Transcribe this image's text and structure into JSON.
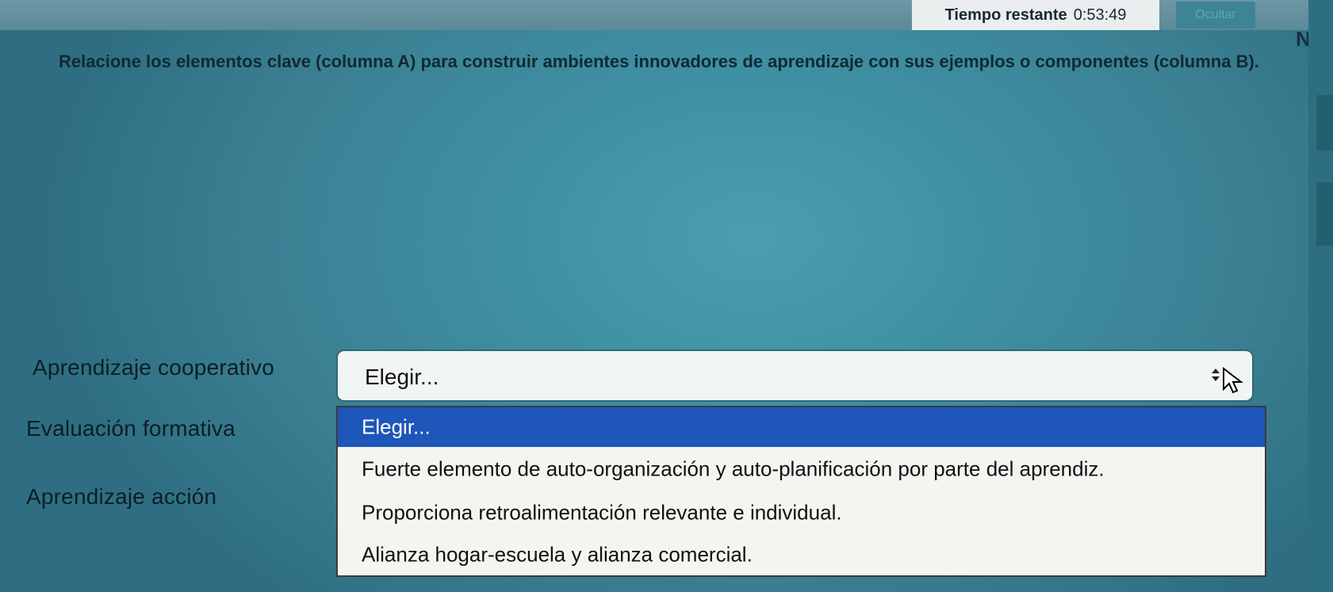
{
  "timer": {
    "label": "Tiempo restante",
    "value": "0:53:49"
  },
  "hide_button": {
    "label": "Ocultar"
  },
  "nav_stub": {
    "label": "Na"
  },
  "question": {
    "text": "Relacione los elementos clave (columna A) para construir ambientes innovadores de aprendizaje con sus ejemplos o componentes (columna B)."
  },
  "rows": [
    {
      "label": "Aprendizaje cooperativo"
    },
    {
      "label": "Evaluación formativa"
    },
    {
      "label": "Aprendizaje acción"
    }
  ],
  "select": {
    "value": "Elegir..."
  },
  "dropdown": {
    "options": [
      {
        "label": "Elegir..."
      },
      {
        "label": "Fuerte elemento de auto-organización y auto-planificación por parte del aprendiz."
      },
      {
        "label": "Proporciona retroalimentación relevante e individual."
      },
      {
        "label": "Alianza hogar-escuela y alianza comercial."
      }
    ],
    "selected_index": 0
  },
  "colors": {
    "accent_selected": "#1e56b9",
    "background": "#3f8fa3"
  },
  "icons": [
    "select-arrows-icon",
    "mouse-cursor-icon"
  ]
}
